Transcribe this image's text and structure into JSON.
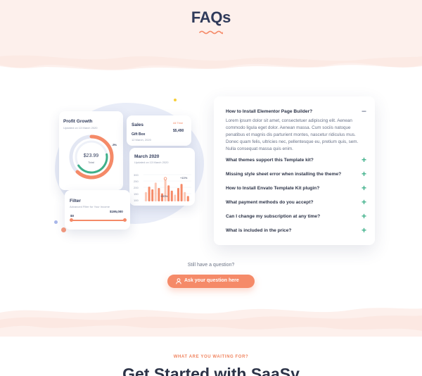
{
  "section": {
    "title": "FAQs"
  },
  "colors": {
    "accent": "#f58a68",
    "heading": "#2f3a5a",
    "plus": "#3fb08a",
    "background_tint": "#fdf0ec"
  },
  "illustration": {
    "profit_card": {
      "title": "Profit Growth",
      "subtitle": "Updated on 13 March 2020",
      "center_value": "$23.99",
      "center_label": "Total",
      "badge": "-5%",
      "progress_fraction": 0.62
    },
    "sales_card": {
      "title": "Sales",
      "period": "All Time",
      "item": "Gift Box",
      "item_date": "12 March, 2020",
      "amount": "$5,490"
    },
    "march_card": {
      "title": "March 2020",
      "subtitle": "Updated on 13 March 2020",
      "axis_labels": [
        "300",
        "250",
        "200",
        "150",
        "100"
      ],
      "badge_top": "+10%",
      "badge_mid": "+20%",
      "bar_values": [
        0.35,
        0.55,
        0.45,
        0.7,
        0.5,
        0.3,
        0.85,
        0.6,
        0.4,
        0.25,
        0.5,
        0.65,
        0.35,
        0.2
      ]
    },
    "filter_card": {
      "title": "Filter",
      "subtitle": "Advanced Filter for Your Income",
      "min": "$0",
      "max": "$195,000"
    }
  },
  "faq": {
    "items": [
      {
        "question": "How to Install Elementor Page Builder?",
        "expanded": true,
        "icon": "minus-icon",
        "answer": "Lorem ipsum dolor sit amet, consectetuer adipiscing elit. Aenean commodo ligula eget dolor. Aenean massa. Cum sociis natoque penatibus et magnis dis parturient montes, nascetur ridiculus mus. Donec quam felis, ultricies nec, pellentesque eu, pretium quis, sem. Nulla consequat massa quis enim."
      },
      {
        "question": "What themes support this Template kit?",
        "expanded": false,
        "icon": "plus-icon"
      },
      {
        "question": "Missing style sheet error when installing the theme?",
        "expanded": false,
        "icon": "plus-icon"
      },
      {
        "question": "How to Install Envato Template Kit plugin?",
        "expanded": false,
        "icon": "plus-icon"
      },
      {
        "question": "What payment methods do you accept?",
        "expanded": false,
        "icon": "plus-icon"
      },
      {
        "question": "Can I change my subscription at any time?",
        "expanded": false,
        "icon": "plus-icon"
      },
      {
        "question": "What is included in the price?",
        "expanded": false,
        "icon": "plus-icon"
      }
    ],
    "toggle_open": "−",
    "toggle_closed": "+"
  },
  "cta": {
    "prompt": "Still have a question?",
    "button_label": "Ask your question here",
    "button_icon": "user-icon"
  },
  "next_section": {
    "eyebrow": "WHAT ARE YOU WAITING FOR?",
    "title": "Get Started with SaaSy"
  }
}
